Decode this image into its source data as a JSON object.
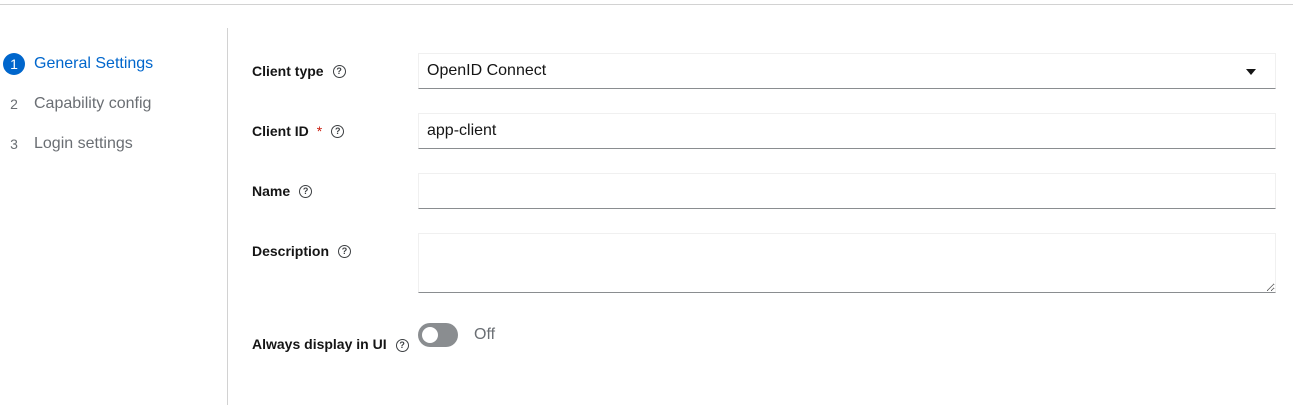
{
  "wizard_steps": [
    {
      "num": "1",
      "label": "General Settings",
      "active": true
    },
    {
      "num": "2",
      "label": "Capability config",
      "active": false
    },
    {
      "num": "3",
      "label": "Login settings",
      "active": false
    }
  ],
  "form": {
    "client_type": {
      "label": "Client type",
      "value": "OpenID Connect"
    },
    "client_id": {
      "label": "Client ID",
      "required_mark": "*",
      "value": "app-client"
    },
    "name": {
      "label": "Name",
      "value": ""
    },
    "description": {
      "label": "Description",
      "value": ""
    },
    "always_display": {
      "label": "Always display in UI",
      "state": "Off"
    }
  },
  "help_glyph": "?",
  "icons": {
    "help": "help-circle-icon",
    "caret": "caret-down-icon"
  },
  "colors": {
    "accent": "#0066cc",
    "required": "#c9190b",
    "toggle_off": "#8a8d90"
  }
}
